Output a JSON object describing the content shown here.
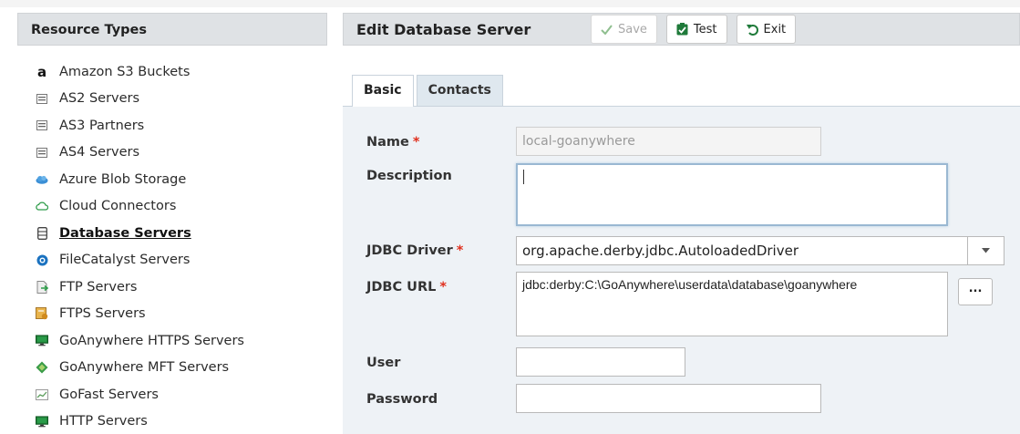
{
  "sidebar": {
    "header": "Resource Types",
    "items": [
      {
        "label": "Amazon S3 Buckets",
        "icon": "amazon-icon"
      },
      {
        "label": "AS2 Servers",
        "icon": "edi-icon"
      },
      {
        "label": "AS3 Partners",
        "icon": "edi-icon"
      },
      {
        "label": "AS4 Servers",
        "icon": "edi-icon"
      },
      {
        "label": "Azure Blob Storage",
        "icon": "azure-cloud-icon"
      },
      {
        "label": "Cloud Connectors",
        "icon": "cloud-outline-icon"
      },
      {
        "label": "Database Servers",
        "icon": "database-icon",
        "active": true
      },
      {
        "label": "FileCatalyst Servers",
        "icon": "filecatalyst-icon"
      },
      {
        "label": "FTP Servers",
        "icon": "ftp-icon"
      },
      {
        "label": "FTPS Servers",
        "icon": "ftps-icon"
      },
      {
        "label": "GoAnywhere HTTPS Servers",
        "icon": "monitor-icon"
      },
      {
        "label": "GoAnywhere MFT Servers",
        "icon": "goanywhere-icon"
      },
      {
        "label": "GoFast Servers",
        "icon": "chart-icon"
      },
      {
        "label": "HTTP Servers",
        "icon": "monitor-icon"
      }
    ]
  },
  "toolbar": {
    "title": "Edit Database Server",
    "save_label": "Save",
    "test_label": "Test",
    "exit_label": "Exit"
  },
  "tabs": {
    "basic": "Basic",
    "contacts": "Contacts"
  },
  "form": {
    "name_label": "Name",
    "name_value": "local-goanywhere",
    "description_label": "Description",
    "description_value": "",
    "jdbc_driver_label": "JDBC Driver",
    "jdbc_driver_value": "org.apache.derby.jdbc.AutoloadedDriver",
    "jdbc_url_label": "JDBC URL",
    "jdbc_url_value": "jdbc:derby:C:\\GoAnywhere\\userdata\\database\\goanywhere",
    "browse_label": "...",
    "user_label": "User",
    "user_value": "",
    "password_label": "Password",
    "password_value": "",
    "required_marker": "*"
  },
  "colors": {
    "header_bg": "#dfe2e5",
    "form_bg": "#eef2f6",
    "required": "#e0301e",
    "save_check": "#7fb07f",
    "test_icon": "#1f7a3a"
  }
}
